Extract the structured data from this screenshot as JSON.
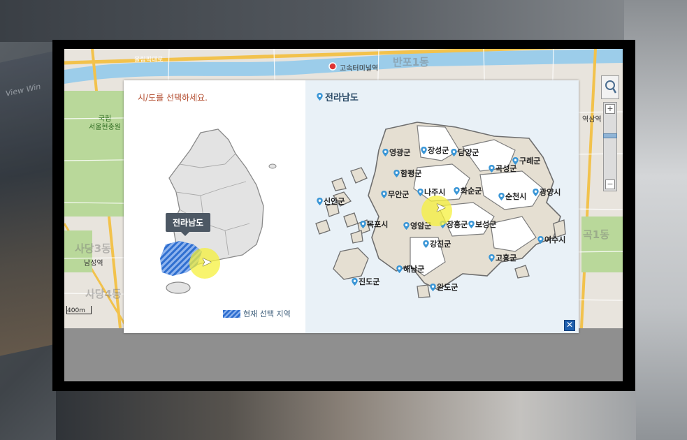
{
  "map_labels": {
    "bus_terminal": "고속터미널역",
    "national_cemetery": "국립\n서울현충원",
    "namseong": "남성역",
    "sadang": "사당3동",
    "sadang4": "사당4동",
    "banpo": "반포1동",
    "scale": "400m",
    "station_right": "역삼역",
    "gok": "곡1동",
    "olympic": "올림픽대로"
  },
  "dialog": {
    "instruction": "시/도를 선택하세요.",
    "selected_region_title": "전라남도",
    "tooltip": "전라남도",
    "legend_label": "현재 선택 지역",
    "close_label": "✕"
  },
  "counties": [
    {
      "name": "영광군"
    },
    {
      "name": "장성군"
    },
    {
      "name": "담양군"
    },
    {
      "name": "곡성군"
    },
    {
      "name": "구례군"
    },
    {
      "name": "함평군"
    },
    {
      "name": "신안군"
    },
    {
      "name": "무안군"
    },
    {
      "name": "나주시"
    },
    {
      "name": "화순군"
    },
    {
      "name": "순천시"
    },
    {
      "name": "광양시"
    },
    {
      "name": "목포시"
    },
    {
      "name": "영암군"
    },
    {
      "name": "장흥군"
    },
    {
      "name": "보성군"
    },
    {
      "name": "여수시"
    },
    {
      "name": "강진군"
    },
    {
      "name": "고흥군"
    },
    {
      "name": "해남군"
    },
    {
      "name": "진도군"
    },
    {
      "name": "완도군"
    }
  ],
  "background": {
    "left_text": "View  Win"
  },
  "colors": {
    "highlight_region": "#2f6fd0",
    "county_land": "#e5dfd2",
    "panel_bg": "#e9f1f7",
    "instruction": "#b24a2c",
    "cursor_highlight": "#f6f03c"
  }
}
